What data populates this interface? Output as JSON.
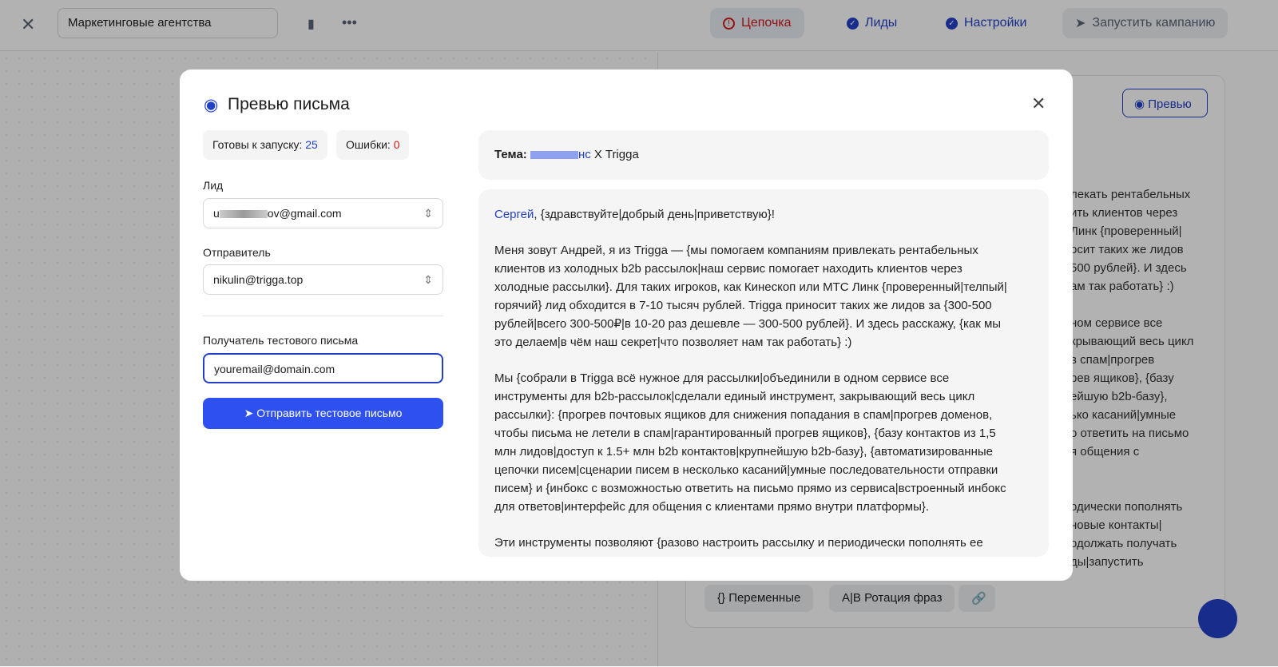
{
  "topbar": {
    "campaign_name": "Маркетинговые агентства",
    "nav": [
      {
        "label": "Цепочка"
      },
      {
        "label": "Лиды"
      },
      {
        "label": "Настройки"
      },
      {
        "label": "Запустить кампанию"
      }
    ]
  },
  "background": {
    "preview_button": "Превью",
    "text_lines": [
      "лекать рентабельных",
      "ить клиентов через",
      "Линк {проверенный|",
      "осит таких же лидов",
      "500 рублей}. И здесь",
      "ам так работать} :)",
      "",
      "ном сервисе все",
      "крывающий весь цикл",
      "в спам|прогрев",
      "рев ящиков}, {базу",
      "ейшую b2b-базу},",
      "ько касаний|умные",
      "о ответить на письмо",
      "я общения с",
      "",
      "",
      "одически пополнять",
      "новые контакты|",
      "одолжать получать",
      "ды|запустить"
    ],
    "chips": [
      "Переменные",
      "Ротация фраз"
    ]
  },
  "modal": {
    "title": "Превью письма",
    "ready_label": "Готовы к запуску:",
    "ready_count": "25",
    "errors_label": "Ошибки:",
    "errors_count": "0",
    "lead_label": "Лид",
    "lead_prefix": "u",
    "lead_suffix": "ov@gmail.com",
    "sender_label": "Отправитель",
    "sender_value": "nikulin@trigga.top",
    "test_label": "Получатель тестового письма",
    "test_value": "youremail@domain.com",
    "send_button": "Отправить тестовое письмо",
    "subject_label": "Тема:",
    "subject_suffix": "нс",
    "subject_rest": " X Trigga",
    "greeting_name": "Сергей",
    "greeting_rest": ", {здравствуйте|добрый день|приветствую}!",
    "paragraphs": [
      "Меня зовут Андрей, я из Trigga — {мы помогаем компаниям привлекать рентабельных клиентов из холодных b2b рассылок|наш сервис помогает находить клиентов через холодные рассылки}. Для таких игроков, как Кинескоп или МТС Линк {проверенный|телпый|горячий} лид обходится в 7-10 тысяч рублей. Trigga приносит таких же лидов за {300-500 рублей|всего 300-500₽|в 10-20 раз дешевле — 300-500 рублей}. И здесь расскажу, {как мы это делаем|в чём наш секрет|что позволяет нам так работать} :)",
      "Мы {собрали в Trigga всё нужное для рассылки|объединили в одном сервисе все инструменты для b2b-рассылок|сделали единый инструмент, закрывающий весь цикл рассылки}: {прогрев почтовых ящиков для снижения попадания в спам|прогрев доменов, чтобы письма не летели в спам|гарантированный прогрев ящиков}, {базу контактов из 1,5 млн лидов|доступ к 1.5+ млн b2b контактов|крупнейшую b2b-базу}, {автоматизированные цепочки писем|сценарии писем в несколько касаний|умные последовательности отправки писем} и {инбокс с возможностью ответить на письмо прямо из сервиса|встроенный инбокс для ответов|интерфейс для общения с клиентами прямо внутри платформы}.",
      "Эти инструменты позволяют {разово настроить рассылку и периодически пополнять ее"
    ]
  }
}
